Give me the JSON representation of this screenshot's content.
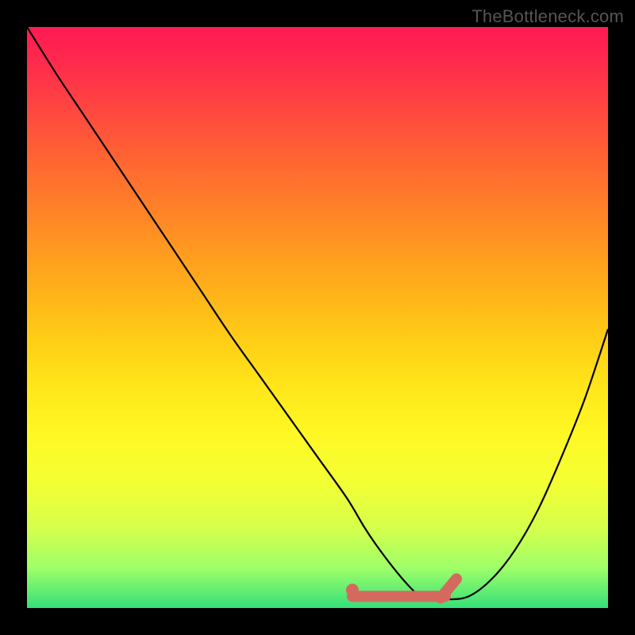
{
  "attribution": "TheBottleneck.com",
  "chart_data": {
    "type": "line",
    "title": "",
    "xlabel": "",
    "ylabel": "",
    "xlim": [
      0,
      100
    ],
    "ylim": [
      0,
      100
    ],
    "series": [
      {
        "name": "curve",
        "x": [
          0,
          5,
          10,
          15,
          20,
          25,
          30,
          35,
          40,
          45,
          50,
          55,
          58,
          60,
          63,
          66,
          68,
          72,
          76,
          80,
          84,
          88,
          92,
          96,
          100
        ],
        "y": [
          100,
          92,
          84.5,
          77,
          69.5,
          62,
          54.5,
          47,
          40,
          33,
          26,
          19,
          14,
          11,
          7,
          3.5,
          2,
          1.5,
          2,
          5,
          10,
          17,
          26,
          36,
          48
        ]
      }
    ],
    "optimal_band": {
      "x_range": [
        56,
        72
      ],
      "y": 2
    },
    "gradient_stops": [
      {
        "offset": 0.0,
        "color": "#ff1a53"
      },
      {
        "offset": 0.06,
        "color": "#ff2a4d"
      },
      {
        "offset": 0.14,
        "color": "#ff4640"
      },
      {
        "offset": 0.22,
        "color": "#ff6233"
      },
      {
        "offset": 0.3,
        "color": "#ff7d29"
      },
      {
        "offset": 0.38,
        "color": "#ff9820"
      },
      {
        "offset": 0.46,
        "color": "#ffb319"
      },
      {
        "offset": 0.54,
        "color": "#ffce16"
      },
      {
        "offset": 0.62,
        "color": "#ffe61a"
      },
      {
        "offset": 0.7,
        "color": "#fff824"
      },
      {
        "offset": 0.78,
        "color": "#f4ff33"
      },
      {
        "offset": 0.86,
        "color": "#d6ff4a"
      },
      {
        "offset": 0.93,
        "color": "#a0ff68"
      },
      {
        "offset": 1.0,
        "color": "#35e07a"
      }
    ],
    "curve_color": "#000000",
    "marker_color": "#d46a5f"
  }
}
